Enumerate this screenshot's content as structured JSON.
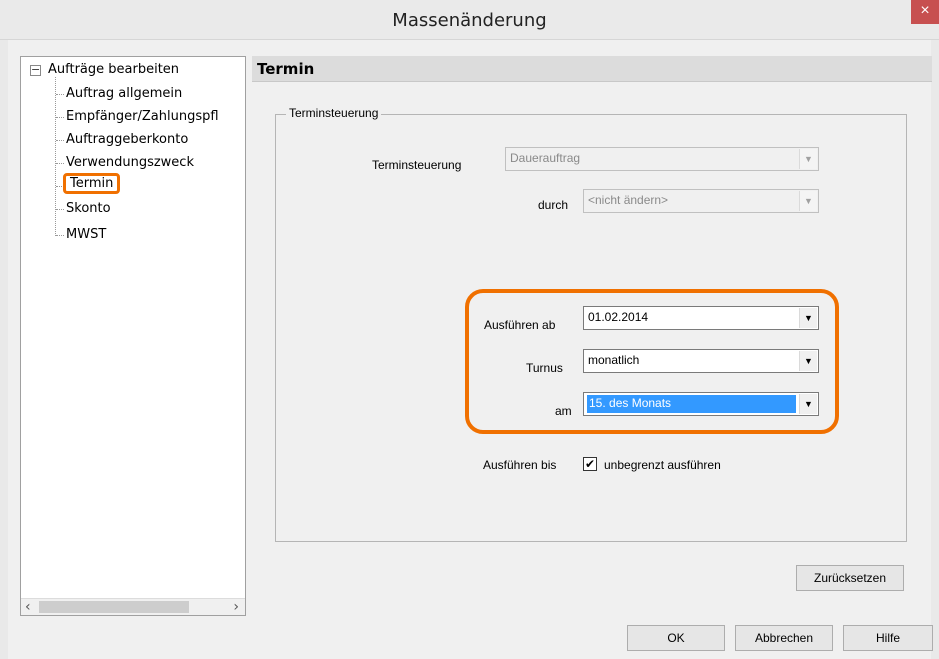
{
  "window": {
    "title": "Massenänderung",
    "close_symbol": "×"
  },
  "tree": {
    "root_label": "Aufträge bearbeiten",
    "expander_symbol": "−",
    "items": [
      {
        "label": "Auftrag allgemein"
      },
      {
        "label": "Empfänger/Zahlungspfl"
      },
      {
        "label": "Auftraggeberkonto"
      },
      {
        "label": "Verwendungszweck"
      },
      {
        "label": "Termin",
        "selected": true
      },
      {
        "label": "Skonto"
      },
      {
        "label": "MWST"
      }
    ],
    "scroll_left": "‹",
    "scroll_right": "›"
  },
  "section": {
    "title": "Termin"
  },
  "group": {
    "legend": "Terminsteuerung"
  },
  "form": {
    "terminsteuerung_label": "Terminsteuerung",
    "terminsteuerung_value": "Dauerauftrag",
    "durch_label": "durch",
    "durch_value": "<nicht ändern>",
    "ausfuehren_ab_label": "Ausführen ab",
    "ausfuehren_ab_value": "01.02.2014",
    "turnus_label": "Turnus",
    "turnus_value": "monatlich",
    "am_label": "am",
    "am_value": "15. des Monats",
    "ausfuehren_bis_label": "Ausführen bis",
    "unbegrenzt_label": "unbegrenzt ausführen",
    "unbegrenzt_checked": true,
    "check_mark": "✔",
    "arrow_symbol": "▼"
  },
  "buttons": {
    "reset": "Zurücksetzen",
    "ok": "OK",
    "cancel": "Abbrechen",
    "help": "Hilfe"
  },
  "colors": {
    "highlight": "#f07000",
    "selection": "#3399ff"
  }
}
